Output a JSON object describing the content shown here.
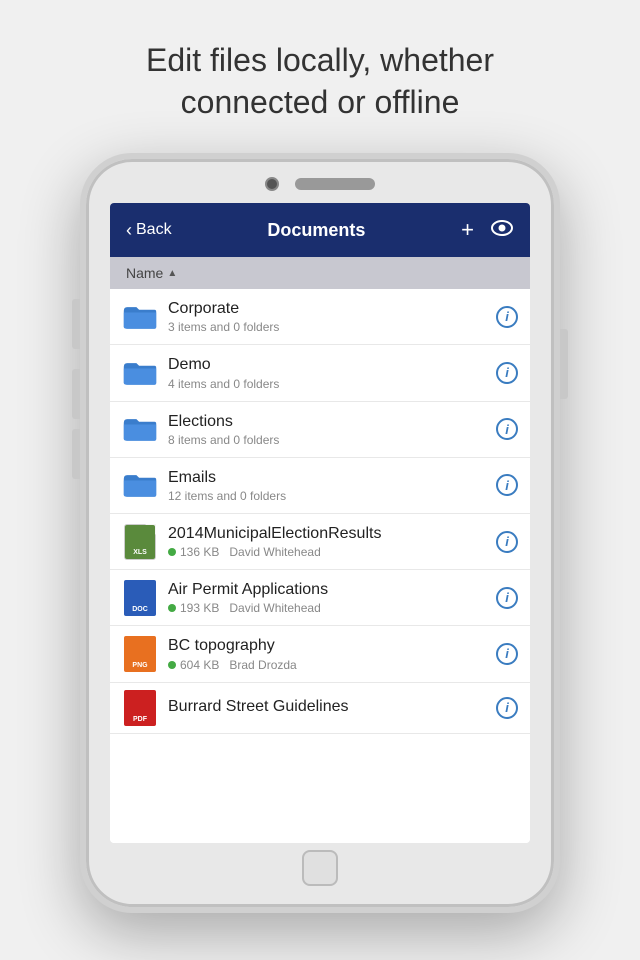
{
  "tagline": {
    "line1": "Edit files locally, whether",
    "line2": "connected or offline"
  },
  "navbar": {
    "back_label": "Back",
    "title": "Documents",
    "plus_label": "+",
    "eye_label": "👁"
  },
  "sort_header": {
    "label": "Name",
    "arrow": "▲"
  },
  "items": [
    {
      "type": "folder",
      "name": "Corporate",
      "meta": "3 items and 0 folders",
      "has_info": true
    },
    {
      "type": "folder",
      "name": "Demo",
      "meta": "4 items and 0 folders",
      "has_info": true
    },
    {
      "type": "folder",
      "name": "Elections",
      "meta": "8 items and 0 folders",
      "has_info": true
    },
    {
      "type": "folder",
      "name": "Emails",
      "meta": "12 items and 0 folders",
      "has_info": true
    },
    {
      "type": "file",
      "file_type": "xls",
      "name": "2014MunicipalElectionResults",
      "size": "136 KB",
      "author": "David Whitehead",
      "has_info": true
    },
    {
      "type": "file",
      "file_type": "doc",
      "name": "Air Permit Applications",
      "size": "193 KB",
      "author": "David Whitehead",
      "has_info": true
    },
    {
      "type": "file",
      "file_type": "png",
      "name": "BC topography",
      "size": "604 KB",
      "author": "Brad Drozda",
      "has_info": true
    },
    {
      "type": "file",
      "file_type": "pdf",
      "name": "Burrard Street Guidelines",
      "size": "",
      "author": "",
      "has_info": true,
      "partial": true
    }
  ]
}
